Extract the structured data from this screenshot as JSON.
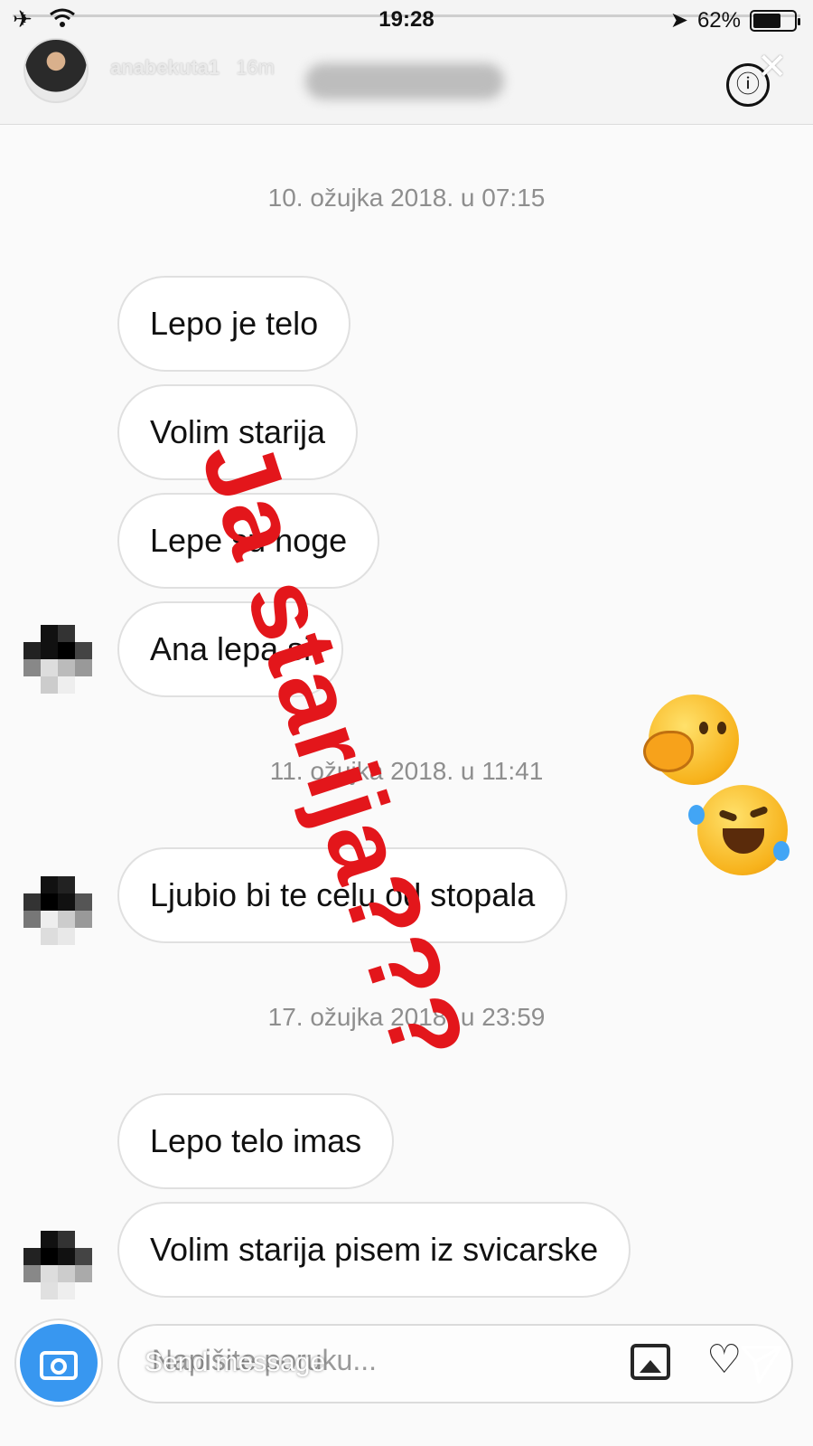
{
  "status_bar": {
    "time": "19:28",
    "battery": "62%"
  },
  "header": {
    "username": "anabekuta1",
    "time_ago": "16m",
    "info_icon": "ⓘ",
    "close_icon": "✕"
  },
  "overlay": {
    "text": "Ja starija???"
  },
  "messages": {
    "stamps": [
      "10. ožujka 2018. u 07:15",
      "11. ožujka 2018. u 11:41",
      "17. ožujka 2018. u 23:59"
    ],
    "bubbles": [
      "Lepo je telo",
      "Volim starija",
      "Lepe su noge",
      "Ana lepa si",
      "Ljubio bi te celu od stopala",
      "Lepo telo imas",
      "Volim starija pisem iz svicarske"
    ]
  },
  "composer": {
    "placeholder": "Napišite poruku...",
    "send_overlay": "Send message"
  },
  "colors": {
    "overlay_red": "#e3161b",
    "camera_blue": "#3897f0"
  }
}
